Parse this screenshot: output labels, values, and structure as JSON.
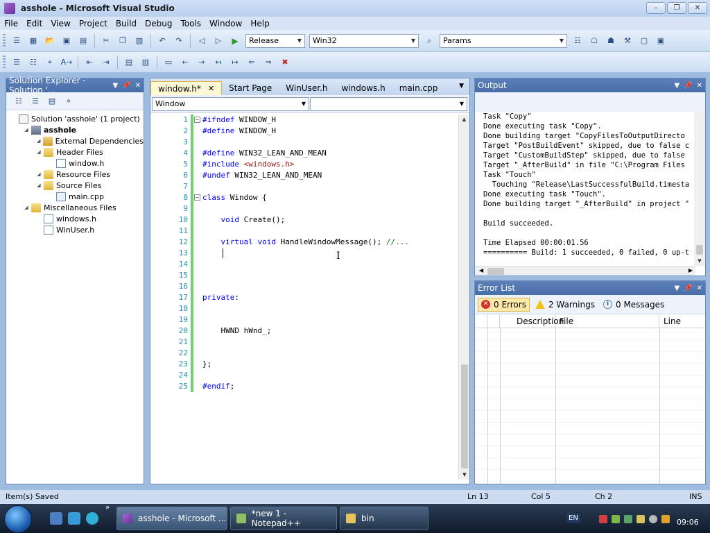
{
  "window": {
    "title": "asshole - Microsoft Visual Studio"
  },
  "menu": [
    "File",
    "Edit",
    "View",
    "Project",
    "Build",
    "Debug",
    "Tools",
    "Window",
    "Help"
  ],
  "toolbar": {
    "config": "Release",
    "platform": "Win32",
    "find": "Params"
  },
  "solution_explorer": {
    "title": "Solution Explorer - Solution '...",
    "tree": [
      {
        "label": "Solution 'asshole' (1 project)",
        "type": "sol",
        "indent": 0
      },
      {
        "label": "asshole",
        "type": "proj",
        "indent": 1,
        "bold": true
      },
      {
        "label": "External Dependencies",
        "type": "dep",
        "indent": 2
      },
      {
        "label": "Header Files",
        "type": "folder",
        "indent": 2
      },
      {
        "label": "window.h",
        "type": "file",
        "indent": 3
      },
      {
        "label": "Resource Files",
        "type": "folder",
        "indent": 2
      },
      {
        "label": "Source Files",
        "type": "folder",
        "indent": 2
      },
      {
        "label": "main.cpp",
        "type": "cpp",
        "indent": 3
      },
      {
        "label": "Miscellaneous Files",
        "type": "folder",
        "indent": 1
      },
      {
        "label": "windows.h",
        "type": "file",
        "indent": 2
      },
      {
        "label": "WinUser.h",
        "type": "file",
        "indent": 2
      }
    ]
  },
  "editor": {
    "tabs": [
      {
        "label": "window.h*",
        "active": true
      },
      {
        "label": "Start Page"
      },
      {
        "label": "WinUser.h"
      },
      {
        "label": "windows.h"
      },
      {
        "label": "main.cpp"
      }
    ],
    "nav_left": "Window",
    "nav_right": "",
    "lines": [
      {
        "n": "1",
        "html": "<span class='kw'>#ifndef</span> WINDOW_H",
        "fold": "-"
      },
      {
        "n": "2",
        "html": "<span class='kw'>#define</span> WINDOW_H"
      },
      {
        "n": "3",
        "html": ""
      },
      {
        "n": "4",
        "html": "<span class='kw'>#define</span> WIN32_LEAN_AND_MEAN"
      },
      {
        "n": "5",
        "html": "<span class='kw'>#include</span> <span class='str'>&lt;windows.h&gt;</span>"
      },
      {
        "n": "6",
        "html": "<span class='kw'>#undef</span> WIN32_LEAN_AND_MEAN"
      },
      {
        "n": "7",
        "html": ""
      },
      {
        "n": "8",
        "html": "<span class='kw'>class</span> Window {",
        "fold": "-"
      },
      {
        "n": "9",
        "html": ""
      },
      {
        "n": "10",
        "html": "    <span class='kw'>void</span> Create();"
      },
      {
        "n": "11",
        "html": ""
      },
      {
        "n": "12",
        "html": "    <span class='kw'>virtual</span> <span class='kw'>void</span> HandleWindowMessage(); <span class='cmt'>//...</span>"
      },
      {
        "n": "13",
        "html": ""
      },
      {
        "n": "14",
        "html": ""
      },
      {
        "n": "15",
        "html": ""
      },
      {
        "n": "16",
        "html": ""
      },
      {
        "n": "17",
        "html": "<span class='kw'>private</span>:"
      },
      {
        "n": "18",
        "html": ""
      },
      {
        "n": "19",
        "html": ""
      },
      {
        "n": "20",
        "html": "    HWND hWnd_;"
      },
      {
        "n": "21",
        "html": ""
      },
      {
        "n": "22",
        "html": ""
      },
      {
        "n": "23",
        "html": "};"
      },
      {
        "n": "24",
        "html": ""
      },
      {
        "n": "25",
        "html": "<span class='kw'>#endif</span>;"
      }
    ]
  },
  "output": {
    "title": "Output",
    "lines": [
      "Task \"Copy\"",
      "Done executing task \"Copy\".",
      "Done building target \"CopyFilesToOutputDirecto",
      "Target \"PostBuildEvent\" skipped, due to false c",
      "Target \"CustomBuildStep\" skipped, due to false",
      "Target \"_AfterBuild\" in file \"C:\\Program Files",
      "Task \"Touch\"",
      "  Touching \"Release\\LastSuccessfulBuild.timesta",
      "Done executing task \"Touch\".",
      "Done building target \"_AfterBuild\" in project \"",
      "",
      "Build succeeded.",
      "",
      "Time Elapsed 00:00:01.56",
      "========== Build: 1 succeeded, 0 failed, 0 up-t"
    ]
  },
  "error_list": {
    "title": "Error List",
    "errors": "0 Errors",
    "warnings": "2 Warnings",
    "messages": "0 Messages",
    "columns": [
      "",
      "",
      "Description",
      "File",
      "Line"
    ]
  },
  "status": {
    "message": "Item(s) Saved",
    "ln": "Ln 13",
    "col": "Col 5",
    "ch": "Ch 2",
    "mode": "INS"
  },
  "taskbar": {
    "items": [
      {
        "label": "asshole - Microsoft ...",
        "active": true
      },
      {
        "label": "*new  1 - Notepad++"
      },
      {
        "label": "bin"
      }
    ],
    "lang": "EN",
    "time": "09:06"
  }
}
